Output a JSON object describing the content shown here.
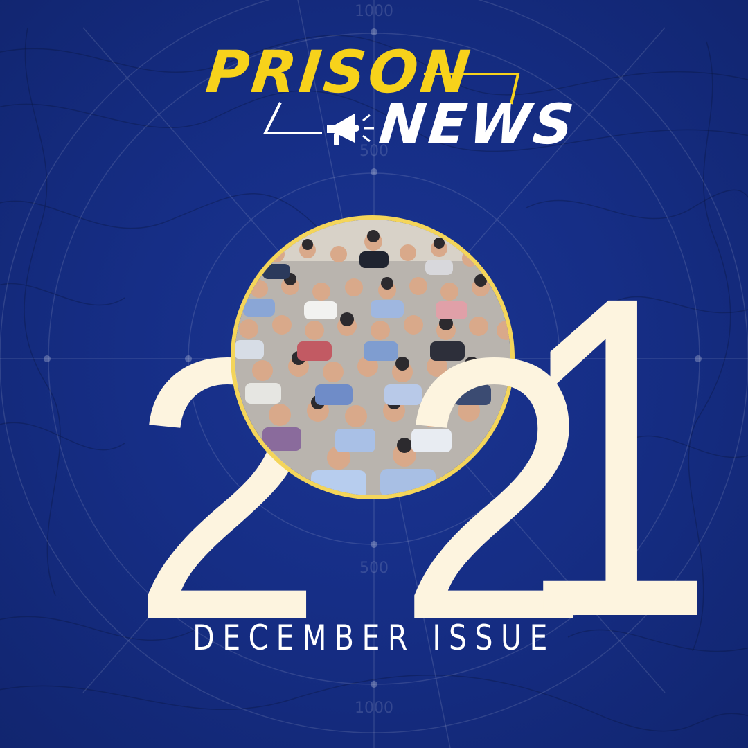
{
  "logo": {
    "word1": "PRISON",
    "word2": "NEWS",
    "icon": "megaphone-icon"
  },
  "year": {
    "d1": "2",
    "d2": "2",
    "d3": "1",
    "photo": "group-photo-crowd"
  },
  "issue": "DECEMBER ISSUE",
  "radar_labels": {
    "top": "1000",
    "upper": "500",
    "lower": "500",
    "bottom": "1000"
  },
  "colors": {
    "background": "#162e86",
    "accent_yellow": "#f7d21b",
    "cream": "#fdf4df",
    "ring": "#f4d55a"
  }
}
